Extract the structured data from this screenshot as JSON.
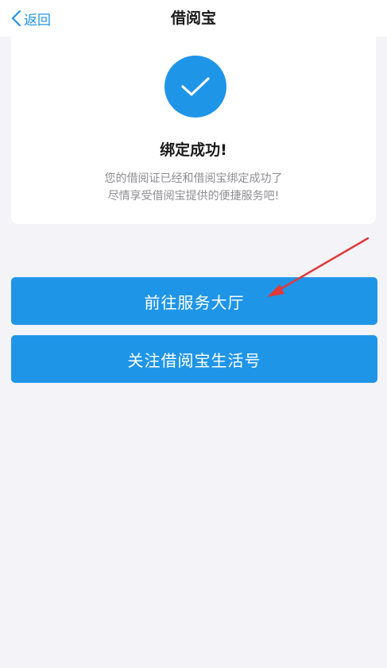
{
  "navbar": {
    "back_label": "返回",
    "title": "借阅宝"
  },
  "card": {
    "icon": "check-icon",
    "title": "绑定成功!",
    "desc_line1": "您的借阅证已经和借阅宝绑定成功了",
    "desc_line2": "尽情享受借阅宝提供的便捷服务吧!"
  },
  "buttons": {
    "primary_label": "前往服务大厅",
    "secondary_label": "关注借阅宝生活号"
  },
  "colors": {
    "accent": "#1f95e8",
    "background": "#f3f3f8",
    "annotation_arrow": "#e03a3a"
  }
}
